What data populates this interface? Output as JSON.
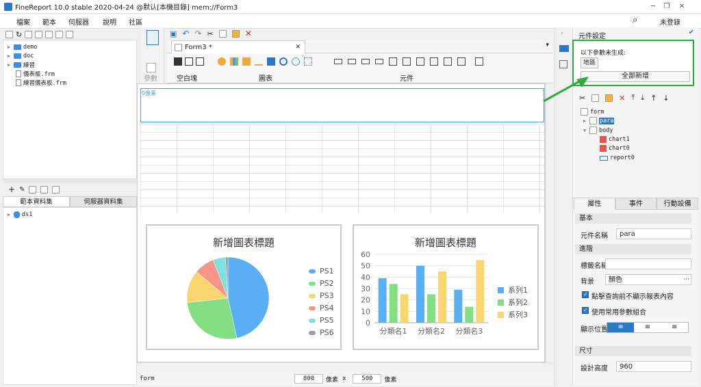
{
  "window": {
    "title": "FineReport 10.0 stable 2020-04-24 @默认[本機目錄]   mem://Form3"
  },
  "menu": [
    "檔案",
    "範本",
    "伺服器",
    "說明",
    "社區"
  ],
  "login": "未登錄",
  "left_tree": {
    "items": [
      {
        "label": "demo",
        "type": "folder"
      },
      {
        "label": "doc",
        "type": "folder"
      },
      {
        "label": "練習",
        "type": "folder"
      },
      {
        "label": "儀表板.frm",
        "type": "file"
      },
      {
        "label": "練習儀表板.frm",
        "type": "file"
      }
    ]
  },
  "dataset_tabs": [
    "範本資料集",
    "伺服器資料集"
  ],
  "datasets": [
    "ds1"
  ],
  "tab": {
    "label": "Form3 *"
  },
  "ribbon": {
    "param": "參數",
    "blank": "空白塊",
    "chart": "圖表",
    "widget": "元件"
  },
  "param_area_label": "0像素",
  "charts": [
    {
      "title": "新增圖表標題",
      "type": "pie",
      "legend": [
        "PS1",
        "PS2",
        "PS3",
        "PS4",
        "PS5",
        "PS6"
      ],
      "colors": [
        "#5aaff4",
        "#84df84",
        "#f9d570",
        "#f59588",
        "#7ee0dc",
        "#9a9aaa"
      ]
    },
    {
      "title": "新增圖表標題",
      "type": "bar",
      "categories": [
        "分類名1",
        "分類名2",
        "分類名3"
      ],
      "yticks": [
        "0",
        "10",
        "20",
        "30",
        "40",
        "50",
        "60"
      ],
      "legend": [
        "系列1",
        "系列2",
        "系列3"
      ],
      "colors": [
        "#5aaff4",
        "#84df84",
        "#f9d570"
      ]
    }
  ],
  "chart_data": [
    {
      "type": "pie",
      "title": "新增圖表標題",
      "categories": [
        "PS1",
        "PS2",
        "PS3",
        "PS4",
        "PS5",
        "PS6"
      ],
      "values": [
        47,
        27,
        13,
        8,
        5,
        1
      ]
    },
    {
      "type": "bar",
      "title": "新增圖表標題",
      "categories": [
        "分類名1",
        "分類名2",
        "分類名3"
      ],
      "ylim": [
        0,
        60
      ],
      "series": [
        {
          "name": "系列1",
          "values": [
            39,
            50,
            29
          ]
        },
        {
          "name": "系列2",
          "values": [
            34,
            25,
            14
          ]
        },
        {
          "name": "系列3",
          "values": [
            25,
            45,
            55
          ]
        }
      ]
    }
  ],
  "status": {
    "left": "form",
    "width": "800",
    "unit": "像素",
    "x": "x",
    "height": "500",
    "unit2": "像素"
  },
  "right_panel": {
    "title": "元件設定",
    "notice": "以下參數未生成:",
    "param_chip": "地區",
    "add_all": "全部新增",
    "tree": [
      "form",
      "para",
      "body",
      "chart1",
      "chart0",
      "report0"
    ],
    "tabs": [
      "屬性",
      "事件",
      "行動設備"
    ],
    "sections": {
      "basic": "基本",
      "advanced": "進階",
      "size": "尺寸"
    },
    "fields": {
      "widget_name_label": "元件名稱",
      "widget_name": "para",
      "tag_name_label": "標籤名稱",
      "bg_label": "背景",
      "bg_value": "顏色",
      "check1": "點擊查詢前不顯示報表內容",
      "check2": "使用常用參數組合",
      "pos_label": "顯示位置",
      "design_height_label": "設計高度",
      "design_height": "960"
    }
  }
}
